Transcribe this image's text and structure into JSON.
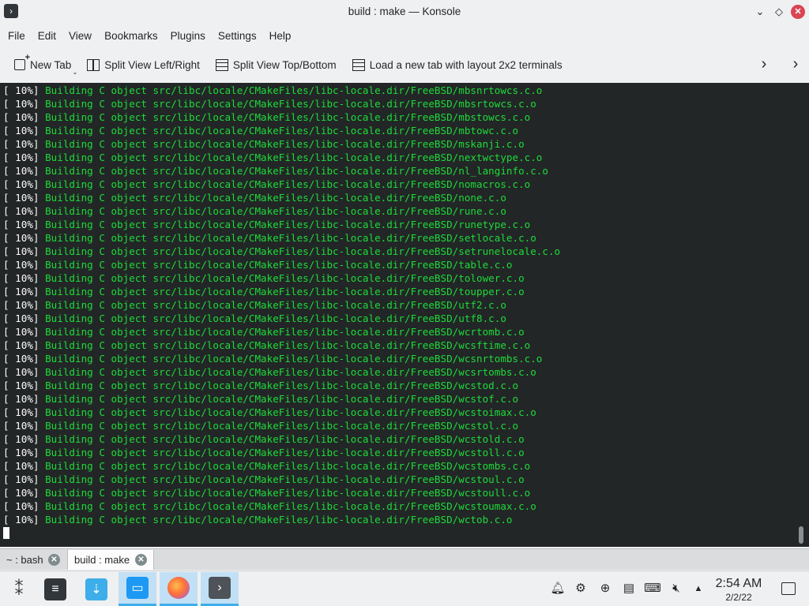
{
  "window": {
    "title": "build : make — Konsole",
    "app_icon": "konsole-icon",
    "controls": {
      "minimize": "⌄",
      "maximize": "◇",
      "close": "✕"
    }
  },
  "menubar": {
    "items": [
      "File",
      "Edit",
      "View",
      "Bookmarks",
      "Plugins",
      "Settings",
      "Help"
    ]
  },
  "toolbar": {
    "new_tab": "New Tab",
    "split_lr": "Split View Left/Right",
    "split_tb": "Split View Top/Bottom",
    "layout_2x2": "Load a new tab with layout 2x2 terminals"
  },
  "terminal": {
    "colors": {
      "background": "#232627",
      "percent": "#fcfcfc",
      "build_text": "#1cdc38"
    },
    "lines": [
      {
        "pct": "[ 10%]",
        "text": " Building C object src/libc/locale/CMakeFiles/libc-locale.dir/FreeBSD/mbsnrtowcs.c.o"
      },
      {
        "pct": "[ 10%]",
        "text": " Building C object src/libc/locale/CMakeFiles/libc-locale.dir/FreeBSD/mbsrtowcs.c.o"
      },
      {
        "pct": "[ 10%]",
        "text": " Building C object src/libc/locale/CMakeFiles/libc-locale.dir/FreeBSD/mbstowcs.c.o"
      },
      {
        "pct": "[ 10%]",
        "text": " Building C object src/libc/locale/CMakeFiles/libc-locale.dir/FreeBSD/mbtowc.c.o"
      },
      {
        "pct": "[ 10%]",
        "text": " Building C object src/libc/locale/CMakeFiles/libc-locale.dir/FreeBSD/mskanji.c.o"
      },
      {
        "pct": "[ 10%]",
        "text": " Building C object src/libc/locale/CMakeFiles/libc-locale.dir/FreeBSD/nextwctype.c.o"
      },
      {
        "pct": "[ 10%]",
        "text": " Building C object src/libc/locale/CMakeFiles/libc-locale.dir/FreeBSD/nl_langinfo.c.o"
      },
      {
        "pct": "[ 10%]",
        "text": " Building C object src/libc/locale/CMakeFiles/libc-locale.dir/FreeBSD/nomacros.c.o"
      },
      {
        "pct": "[ 10%]",
        "text": " Building C object src/libc/locale/CMakeFiles/libc-locale.dir/FreeBSD/none.c.o"
      },
      {
        "pct": "[ 10%]",
        "text": " Building C object src/libc/locale/CMakeFiles/libc-locale.dir/FreeBSD/rune.c.o"
      },
      {
        "pct": "[ 10%]",
        "text": " Building C object src/libc/locale/CMakeFiles/libc-locale.dir/FreeBSD/runetype.c.o"
      },
      {
        "pct": "[ 10%]",
        "text": " Building C object src/libc/locale/CMakeFiles/libc-locale.dir/FreeBSD/setlocale.c.o"
      },
      {
        "pct": "[ 10%]",
        "text": " Building C object src/libc/locale/CMakeFiles/libc-locale.dir/FreeBSD/setrunelocale.c.o"
      },
      {
        "pct": "[ 10%]",
        "text": " Building C object src/libc/locale/CMakeFiles/libc-locale.dir/FreeBSD/table.c.o"
      },
      {
        "pct": "[ 10%]",
        "text": " Building C object src/libc/locale/CMakeFiles/libc-locale.dir/FreeBSD/tolower.c.o"
      },
      {
        "pct": "[ 10%]",
        "text": " Building C object src/libc/locale/CMakeFiles/libc-locale.dir/FreeBSD/toupper.c.o"
      },
      {
        "pct": "[ 10%]",
        "text": " Building C object src/libc/locale/CMakeFiles/libc-locale.dir/FreeBSD/utf2.c.o"
      },
      {
        "pct": "[ 10%]",
        "text": " Building C object src/libc/locale/CMakeFiles/libc-locale.dir/FreeBSD/utf8.c.o"
      },
      {
        "pct": "[ 10%]",
        "text": " Building C object src/libc/locale/CMakeFiles/libc-locale.dir/FreeBSD/wcrtomb.c.o"
      },
      {
        "pct": "[ 10%]",
        "text": " Building C object src/libc/locale/CMakeFiles/libc-locale.dir/FreeBSD/wcsftime.c.o"
      },
      {
        "pct": "[ 10%]",
        "text": " Building C object src/libc/locale/CMakeFiles/libc-locale.dir/FreeBSD/wcsnrtombs.c.o"
      },
      {
        "pct": "[ 10%]",
        "text": " Building C object src/libc/locale/CMakeFiles/libc-locale.dir/FreeBSD/wcsrtombs.c.o"
      },
      {
        "pct": "[ 10%]",
        "text": " Building C object src/libc/locale/CMakeFiles/libc-locale.dir/FreeBSD/wcstod.c.o"
      },
      {
        "pct": "[ 10%]",
        "text": " Building C object src/libc/locale/CMakeFiles/libc-locale.dir/FreeBSD/wcstof.c.o"
      },
      {
        "pct": "[ 10%]",
        "text": " Building C object src/libc/locale/CMakeFiles/libc-locale.dir/FreeBSD/wcstoimax.c.o"
      },
      {
        "pct": "[ 10%]",
        "text": " Building C object src/libc/locale/CMakeFiles/libc-locale.dir/FreeBSD/wcstol.c.o"
      },
      {
        "pct": "[ 10%]",
        "text": " Building C object src/libc/locale/CMakeFiles/libc-locale.dir/FreeBSD/wcstold.c.o"
      },
      {
        "pct": "[ 10%]",
        "text": " Building C object src/libc/locale/CMakeFiles/libc-locale.dir/FreeBSD/wcstoll.c.o"
      },
      {
        "pct": "[ 10%]",
        "text": " Building C object src/libc/locale/CMakeFiles/libc-locale.dir/FreeBSD/wcstombs.c.o"
      },
      {
        "pct": "[ 10%]",
        "text": " Building C object src/libc/locale/CMakeFiles/libc-locale.dir/FreeBSD/wcstoul.c.o"
      },
      {
        "pct": "[ 10%]",
        "text": " Building C object src/libc/locale/CMakeFiles/libc-locale.dir/FreeBSD/wcstoull.c.o"
      },
      {
        "pct": "[ 10%]",
        "text": " Building C object src/libc/locale/CMakeFiles/libc-locale.dir/FreeBSD/wcstoumax.c.o"
      },
      {
        "pct": "[ 10%]",
        "text": " Building C object src/libc/locale/CMakeFiles/libc-locale.dir/FreeBSD/wctob.c.o"
      }
    ]
  },
  "session_tabs": [
    {
      "label": "~ : bash",
      "active": false
    },
    {
      "label": "build : make",
      "active": true
    }
  ],
  "taskbar": {
    "apps": [
      "application-launcher-icon",
      "system-settings-icon",
      "discover-icon",
      "file-manager-icon",
      "firefox-icon",
      "konsole-icon"
    ],
    "tray": [
      "notifications-icon",
      "network-icon",
      "updates-icon",
      "clipboard-icon",
      "keyboard-icon",
      "volume-muted-icon",
      "expand-tray-icon"
    ],
    "time": "2:54 AM",
    "date": "2/2/22",
    "accent": "#3daee9"
  }
}
